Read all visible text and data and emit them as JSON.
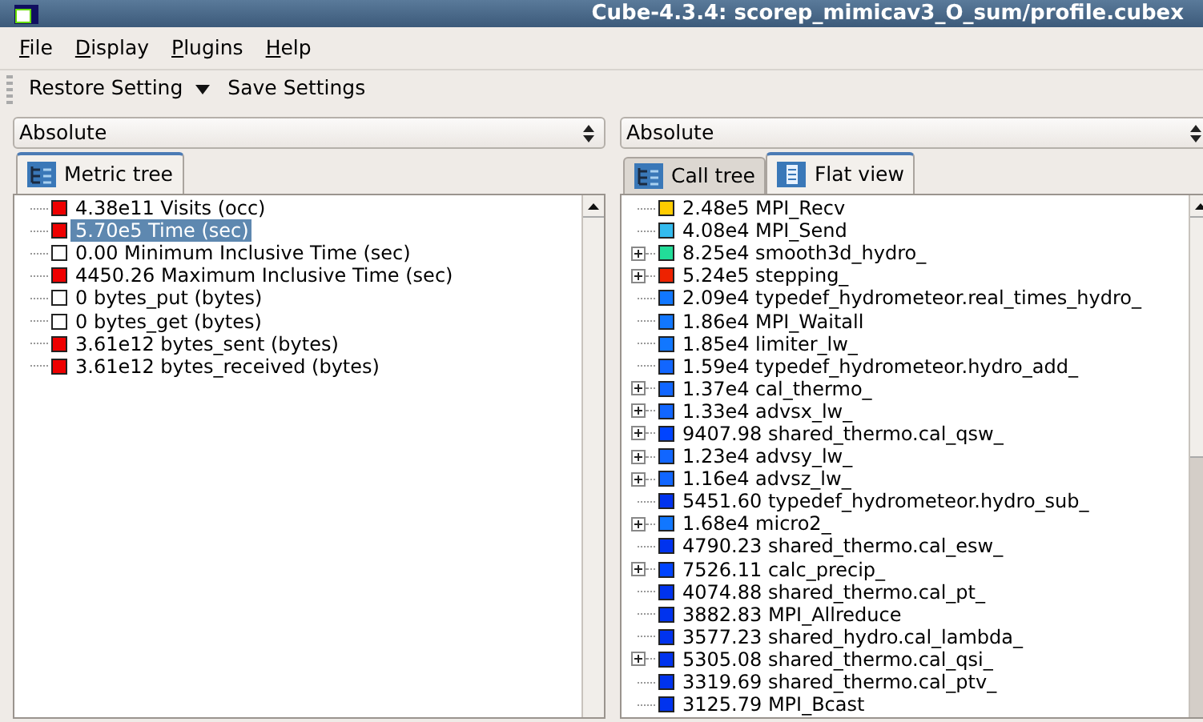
{
  "window": {
    "title": "Cube-4.3.4: scorep_mimicav3_O_sum/profile.cubex"
  },
  "menu": [
    "File",
    "Display",
    "Plugins",
    "Help"
  ],
  "toolbar": {
    "restore": "Restore Setting",
    "save": "Save Settings"
  },
  "panes": [
    {
      "mode": "Absolute",
      "tabs": [
        {
          "label": "Metric tree",
          "kind": "tree",
          "selected": true
        }
      ],
      "rows": [
        {
          "text": "4.38e11 Visits (occ)",
          "color": "#ee0000",
          "expandable": false,
          "selected": false
        },
        {
          "text": "5.70e5 Time (sec)",
          "color": "#ee0000",
          "expandable": false,
          "selected": true
        },
        {
          "text": "0.00 Minimum Inclusive Time (sec)",
          "color": "#ffffff",
          "expandable": false,
          "selected": false
        },
        {
          "text": "4450.26 Maximum Inclusive Time (sec)",
          "color": "#ee0000",
          "expandable": false,
          "selected": false
        },
        {
          "text": "0 bytes_put (bytes)",
          "color": "#ffffff",
          "expandable": false,
          "selected": false
        },
        {
          "text": "0 bytes_get (bytes)",
          "color": "#ffffff",
          "expandable": false,
          "selected": false
        },
        {
          "text": "3.61e12 bytes_sent (bytes)",
          "color": "#ee0000",
          "expandable": false,
          "selected": false
        },
        {
          "text": "3.61e12 bytes_received (bytes)",
          "color": "#ee0000",
          "expandable": false,
          "selected": false
        }
      ]
    },
    {
      "mode": "Absolute",
      "tabs": [
        {
          "label": "Call tree",
          "kind": "tree",
          "selected": false
        },
        {
          "label": "Flat view",
          "kind": "list",
          "selected": true
        }
      ],
      "rows": [
        {
          "text": "2.48e5 MPI_Recv",
          "color": "#ffcc00",
          "expandable": false,
          "selected": false
        },
        {
          "text": "4.08e4 MPI_Send",
          "color": "#33bbee",
          "expandable": false,
          "selected": false
        },
        {
          "text": "8.25e4 smooth3d_hydro_",
          "color": "#22dd99",
          "expandable": true,
          "selected": false
        },
        {
          "text": "5.24e5 stepping_",
          "color": "#ee2200",
          "expandable": true,
          "selected": false
        },
        {
          "text": "2.09e4 typedef_hydrometeor.real_times_hydro_",
          "color": "#1177ff",
          "expandable": false,
          "selected": false
        },
        {
          "text": "1.86e4 MPI_Waitall",
          "color": "#1177ff",
          "expandable": false,
          "selected": false
        },
        {
          "text": "1.85e4 limiter_lw_",
          "color": "#1177ff",
          "expandable": false,
          "selected": false
        },
        {
          "text": "1.59e4 typedef_hydrometeor.hydro_add_",
          "color": "#1166ff",
          "expandable": false,
          "selected": false
        },
        {
          "text": "1.37e4 cal_thermo_",
          "color": "#1166ff",
          "expandable": true,
          "selected": false
        },
        {
          "text": "1.33e4 advsx_lw_",
          "color": "#1166ff",
          "expandable": true,
          "selected": false
        },
        {
          "text": "9407.98 shared_thermo.cal_qsw_",
          "color": "#0044ff",
          "expandable": true,
          "selected": false
        },
        {
          "text": "1.23e4 advsy_lw_",
          "color": "#1166ff",
          "expandable": true,
          "selected": false
        },
        {
          "text": "1.16e4 advsz_lw_",
          "color": "#1166ff",
          "expandable": true,
          "selected": false
        },
        {
          "text": "5451.60 typedef_hydrometeor.hydro_sub_",
          "color": "#0033ee",
          "expandable": false,
          "selected": false
        },
        {
          "text": "1.68e4 micro2_",
          "color": "#1177ff",
          "expandable": true,
          "selected": false
        },
        {
          "text": "4790.23 shared_thermo.cal_esw_",
          "color": "#0033ee",
          "expandable": false,
          "selected": false
        },
        {
          "text": "7526.11 calc_precip_",
          "color": "#0044ff",
          "expandable": true,
          "selected": false
        },
        {
          "text": "4074.88 shared_thermo.cal_pt_",
          "color": "#0033ee",
          "expandable": false,
          "selected": false
        },
        {
          "text": "3882.83 MPI_Allreduce",
          "color": "#0033ee",
          "expandable": false,
          "selected": false
        },
        {
          "text": "3577.23 shared_hydro.cal_lambda_",
          "color": "#0033ee",
          "expandable": false,
          "selected": false
        },
        {
          "text": "5305.08 shared_thermo.cal_qsi_",
          "color": "#0033ee",
          "expandable": true,
          "selected": false
        },
        {
          "text": "3319.69 shared_thermo.cal_ptv_",
          "color": "#0033ee",
          "expandable": false,
          "selected": false
        },
        {
          "text": "3125.79 MPI_Bcast",
          "color": "#0033ee",
          "expandable": false,
          "selected": false
        }
      ]
    }
  ]
}
